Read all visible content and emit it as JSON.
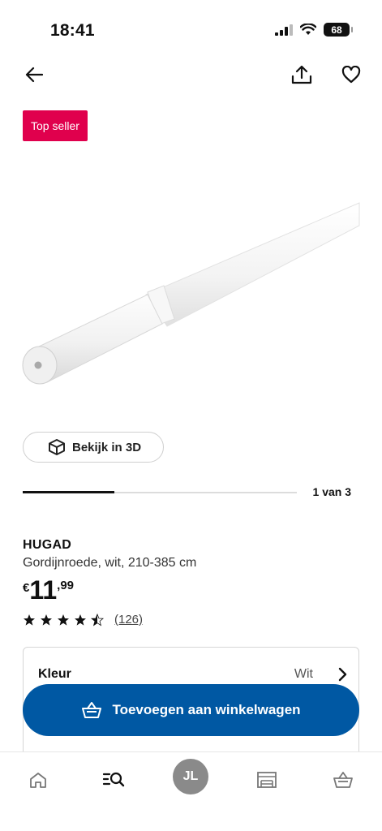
{
  "status_bar": {
    "time": "18:41",
    "battery": "68"
  },
  "product": {
    "badge": "Top seller",
    "view_3d_label": "Bekijk in 3D",
    "carousel": {
      "counter": "1 van 3",
      "progress": 0.333
    },
    "name": "HUGAD",
    "description": "Gordijnroede, wit, 210-385 cm",
    "price": {
      "currency": "€",
      "integer": "11",
      "decimal": ",99"
    },
    "rating": {
      "value": 4.5,
      "max": 5,
      "review_count": "(126)"
    },
    "color_option": {
      "label": "Kleur",
      "value": "Wit"
    }
  },
  "cart_button": {
    "label": "Toevoegen aan winkelwagen"
  },
  "tab_bar": {
    "profile_initials": "JL",
    "items": [
      "home-icon",
      "search-icon",
      "profile-avatar",
      "store-icon",
      "cart-icon"
    ]
  },
  "colors": {
    "badge": "#e0004d",
    "primary": "#0058a3",
    "avatar": "#8a8a8a"
  }
}
